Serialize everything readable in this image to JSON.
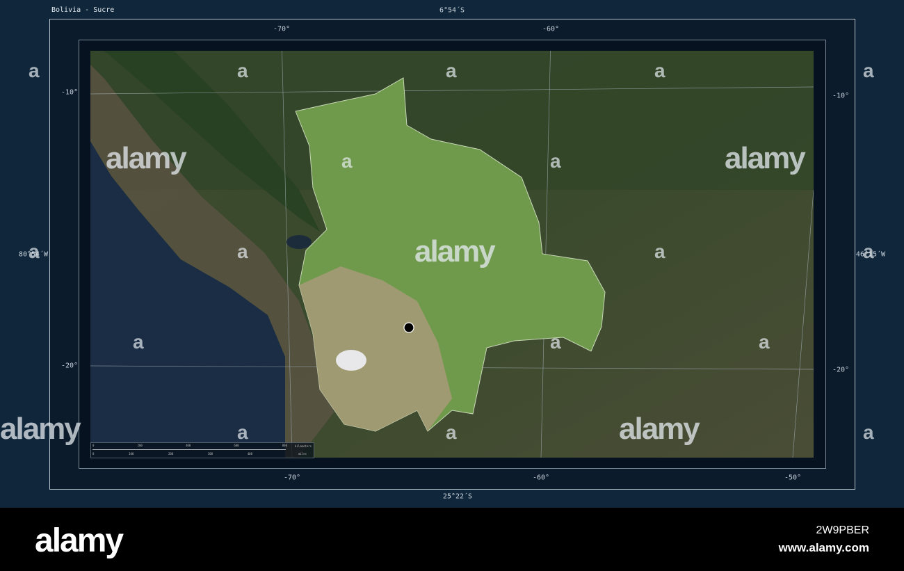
{
  "title": "Bolivia - Sucre",
  "extent": {
    "top": "6°54´S",
    "bottom": "25°22´S",
    "left": "80°54´W",
    "right": "46°15´W"
  },
  "lon_top": [
    "-70°",
    "-60°"
  ],
  "lon_bottom": [
    "-70°",
    "-60°",
    "-50°"
  ],
  "lat_left": [
    "-10°",
    "-20°"
  ],
  "lat_right": [
    "-10°",
    "-20°"
  ],
  "scale": {
    "km_ticks": [
      "0",
      "200",
      "400",
      "600",
      "800"
    ],
    "km_unit": "kilometers",
    "mi_ticks": [
      "0",
      "100",
      "200",
      "300",
      "400"
    ],
    "mi_unit": "miles"
  },
  "marker": {
    "label": "Sucre",
    "color": "#000000"
  },
  "highlight_color": "#9ed88a",
  "watermark": {
    "word": "alamy",
    "letter": "a"
  },
  "footer": {
    "logo": "alamy",
    "image_id": "2W9PBER",
    "url": "www.alamy.com"
  }
}
